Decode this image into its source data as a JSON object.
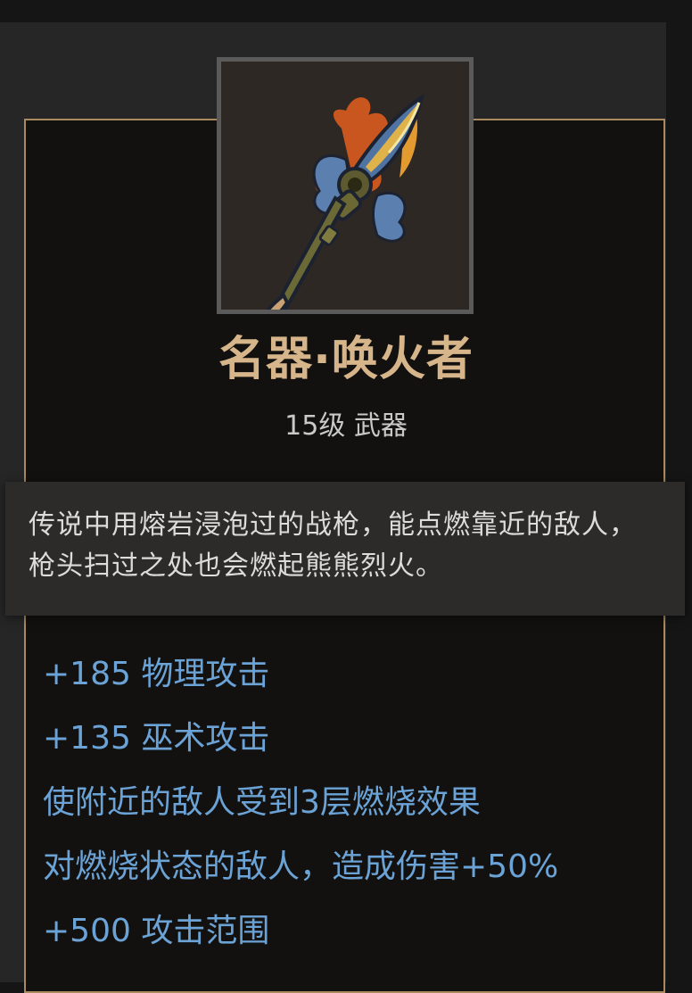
{
  "item": {
    "icon": "fire-spear-icon",
    "name": "名器·唤火者",
    "level_type": "15级 武器",
    "description": "传说中用熔岩浸泡过的战枪，能点燃靠近的敌人，枪头扫过之处也会燃起熊熊烈火。",
    "stats": [
      "+185 物理攻击",
      "+135 巫术攻击",
      "使附近的敌人受到3层燃烧效果",
      "对燃烧状态的敌人，造成伤害+50%",
      "+500 攻击范围"
    ]
  },
  "colors": {
    "name": "#d6b58b",
    "stat": "#6ba3d6",
    "border": "#a88a5e"
  }
}
